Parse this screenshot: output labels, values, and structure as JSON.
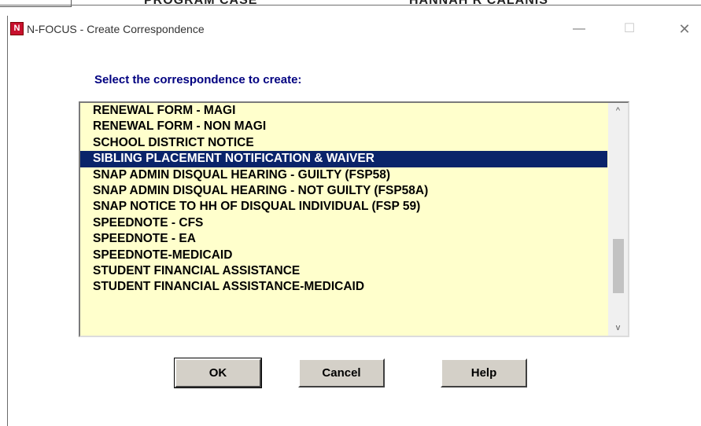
{
  "background": {
    "left_text": "PROGRAM CASE",
    "right_text": "HANNAH R CALANIS"
  },
  "window": {
    "title": "N-FOCUS - Create Correspondence",
    "icon_letter": "N",
    "minimize_glyph": "—",
    "maximize_glyph": "☐",
    "close_glyph": "✕"
  },
  "prompt": "Select the correspondence to create:",
  "list": {
    "items": [
      "RENEWAL FORM - MAGI",
      "RENEWAL FORM - NON MAGI",
      "SCHOOL DISTRICT NOTICE",
      "SIBLING PLACEMENT NOTIFICATION & WAIVER",
      "SNAP ADMIN DISQUAL HEARING - GUILTY (FSP58)",
      "SNAP ADMIN DISQUAL HEARING - NOT GUILTY (FSP58A)",
      "SNAP NOTICE TO HH OF DISQUAL INDIVIDUAL (FSP 59)",
      "SPEEDNOTE - CFS",
      "SPEEDNOTE - EA",
      "SPEEDNOTE-MEDICAID",
      "STUDENT FINANCIAL ASSISTANCE",
      "STUDENT FINANCIAL ASSISTANCE-MEDICAID"
    ],
    "selected_item": "SIBLING PLACEMENT NOTIFICATION & WAIVER",
    "background_color": "#ffffcc",
    "selection_color": "#0a246a"
  },
  "scrollbar": {
    "up_glyph": "^",
    "down_glyph": "v"
  },
  "buttons": {
    "ok": "OK",
    "cancel": "Cancel",
    "help": "Help"
  },
  "colors": {
    "prompt": "#000080",
    "button_face": "#d4d0c8",
    "close_icon": "#777777"
  }
}
